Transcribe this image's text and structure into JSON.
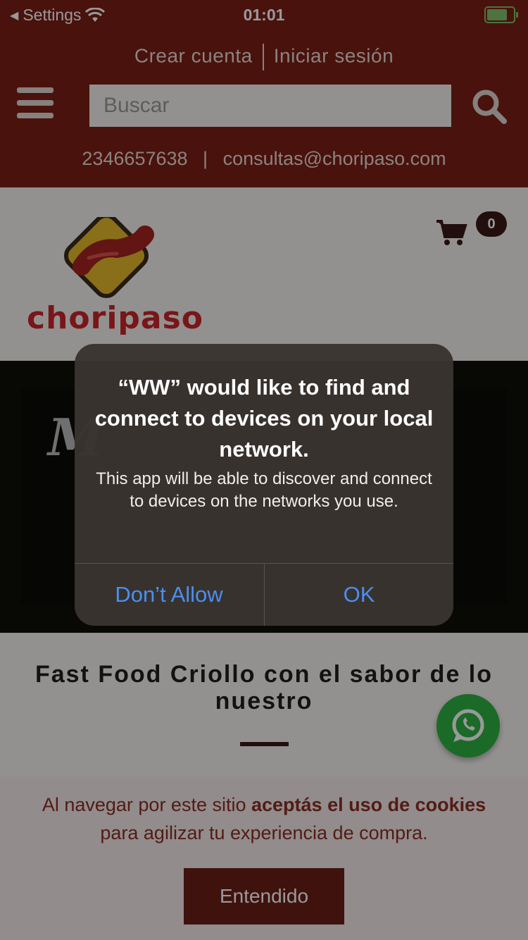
{
  "statusbar": {
    "back_label": "Settings",
    "time": "01:01"
  },
  "header": {
    "create_account": "Crear cuenta",
    "login": "Iniciar sesión",
    "search_placeholder": "Buscar",
    "phone": "2346657638",
    "separator": "|",
    "email": "consultas@choripaso.com"
  },
  "brand": {
    "name": "choripaso"
  },
  "cart": {
    "count": "0"
  },
  "main": {
    "tagline": "Fast Food Criollo con el sabor de lo nuestro"
  },
  "cookie": {
    "text_1": "Al navegar por este sitio ",
    "text_bold": "aceptás el uso de cookies",
    "text_2": " para agilizar tu experiencia de compra.",
    "button": "Entendido"
  },
  "alert": {
    "title": "“WW” would like to find and connect to devices on your local network.",
    "message": "This app will be able to discover and connect to devices on the networks you use.",
    "deny": "Don’t Allow",
    "ok": "OK"
  },
  "colors": {
    "header": "#7a1f14",
    "accent": "#6a1e16",
    "alert_button": "#4a8ff0",
    "whatsapp": "#2db142"
  }
}
